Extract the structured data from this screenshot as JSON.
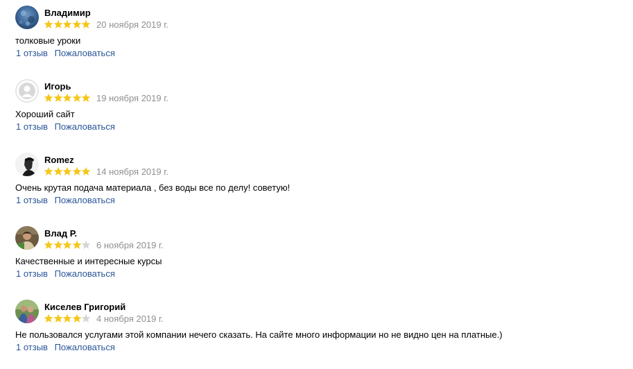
{
  "reviews": [
    {
      "author": "Владимир",
      "rating": 5,
      "date": "20 ноября 2019 г.",
      "text": "толковые уроки",
      "reviews_count_link": "1 отзыв",
      "complain_link": "Пожаловаться",
      "avatar": "blue-abstract-photo"
    },
    {
      "author": "Игорь",
      "rating": 5,
      "date": "19 ноября 2019 г.",
      "text": "Хороший сайт",
      "reviews_count_link": "1 отзыв",
      "complain_link": "Пожаловаться",
      "avatar": "default-user-silhouette"
    },
    {
      "author": "Romez",
      "rating": 5,
      "date": "14 ноября 2019 г.",
      "text": "Очень крутая подача материала , без воды все по делу! советую!",
      "reviews_count_link": "1 отзыв",
      "complain_link": "Пожаловаться",
      "avatar": "dark-profile-photo"
    },
    {
      "author": "Влад Р.",
      "rating": 4,
      "date": "6 ноября 2019 г.",
      "text": "Качественные и интересные курсы",
      "reviews_count_link": "1 отзыв",
      "complain_link": "Пожаловаться",
      "avatar": "man-portrait-photo"
    },
    {
      "author": "Киселев Григорий",
      "rating": 4,
      "date": "4 ноября 2019 г.",
      "text": "Не пользовался услугами этой компании нечего сказать. На сайте много информации но не видно цен на платные.)",
      "reviews_count_link": "1 отзыв",
      "complain_link": "Пожаловаться",
      "avatar": "couple-outdoor-photo"
    }
  ],
  "colors": {
    "star_filled": "#f4c71b",
    "star_empty": "#d6d6d6",
    "link": "#2a5699",
    "date": "#8f8f8f"
  }
}
